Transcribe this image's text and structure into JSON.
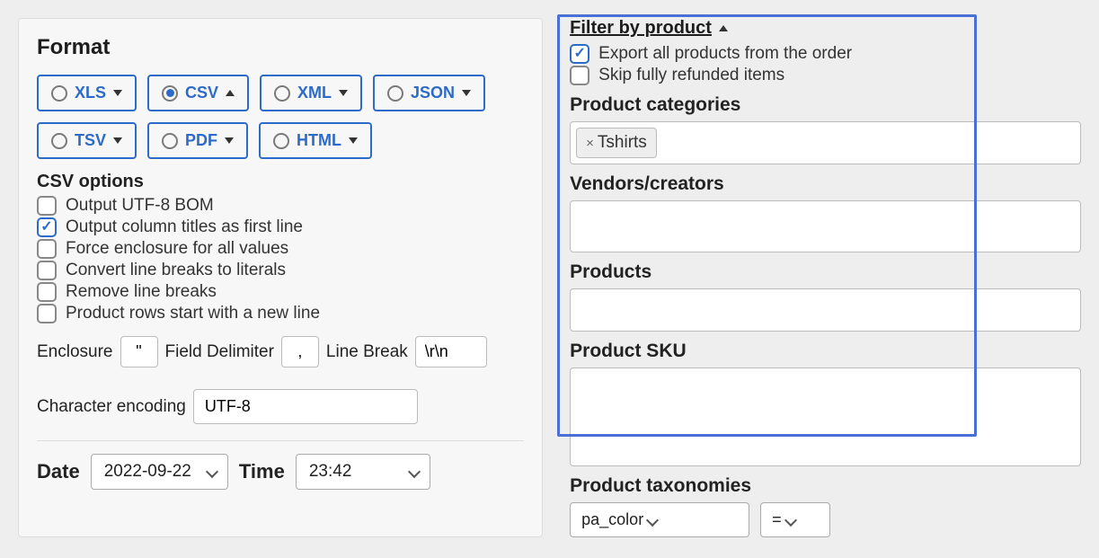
{
  "format": {
    "title": "Format",
    "buttons": [
      {
        "id": "xls",
        "label": "XLS",
        "checked": false,
        "caret": "down"
      },
      {
        "id": "csv",
        "label": "CSV",
        "checked": true,
        "caret": "up"
      },
      {
        "id": "xml",
        "label": "XML",
        "checked": false,
        "caret": "down"
      },
      {
        "id": "json",
        "label": "JSON",
        "checked": false,
        "caret": "down"
      },
      {
        "id": "tsv",
        "label": "TSV",
        "checked": false,
        "caret": "down"
      },
      {
        "id": "pdf",
        "label": "PDF",
        "checked": false,
        "caret": "down"
      },
      {
        "id": "html",
        "label": "HTML",
        "checked": false,
        "caret": "down"
      }
    ],
    "csv_options_title": "CSV options",
    "csv_options": [
      {
        "label": "Output UTF-8 BOM",
        "checked": false
      },
      {
        "label": "Output column titles as first line",
        "checked": true
      },
      {
        "label": "Force enclosure for all values",
        "checked": false
      },
      {
        "label": "Convert line breaks to literals",
        "checked": false
      },
      {
        "label": "Remove line breaks",
        "checked": false
      },
      {
        "label": "Product rows start with a new line",
        "checked": false
      }
    ],
    "fields": {
      "enclosure_label": "Enclosure",
      "enclosure_value": "\"",
      "delimiter_label": "Field Delimiter",
      "delimiter_value": ",",
      "linebreak_label": "Line Break",
      "linebreak_value": "\\r\\n",
      "encoding_label": "Character encoding",
      "encoding_value": "UTF-8"
    },
    "date_label": "Date",
    "date_value": "2022-09-22",
    "time_label": "Time",
    "time_value": "23:42"
  },
  "filter": {
    "title": "Filter by product",
    "export_all": {
      "label": "Export all products from the order",
      "checked": true
    },
    "skip_refunded": {
      "label": "Skip fully refunded items",
      "checked": false
    },
    "product_categories_label": "Product categories",
    "category_tags": [
      "Tshirts"
    ],
    "vendors_label": "Vendors/creators",
    "products_label": "Products",
    "sku_label": "Product SKU",
    "taxonomies_label": "Product taxonomies",
    "taxonomy_value": "pa_color",
    "taxonomy_op": "="
  }
}
